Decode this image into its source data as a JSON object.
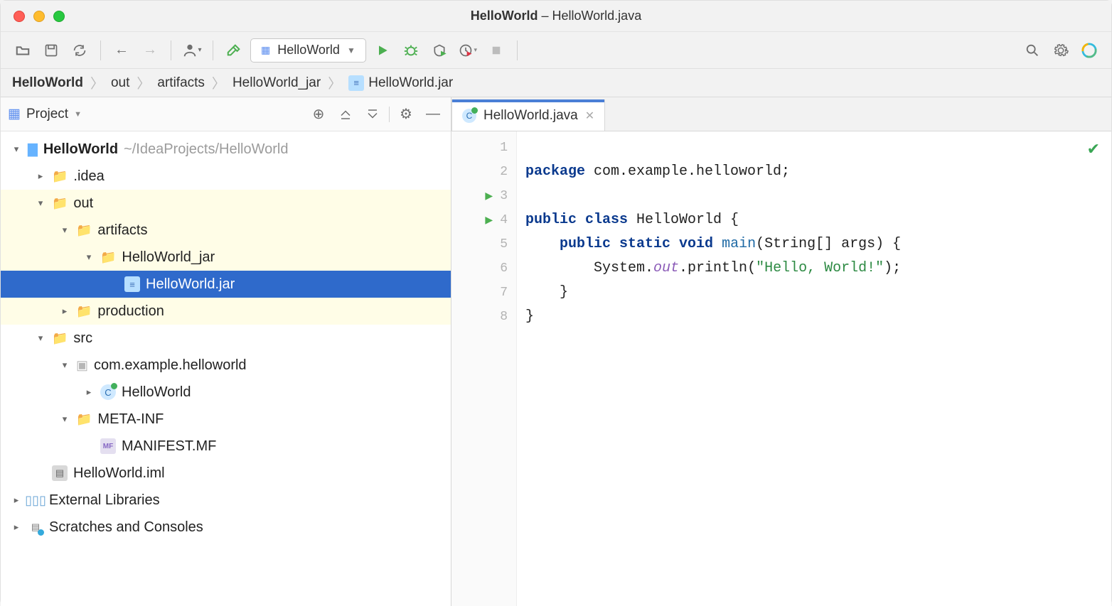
{
  "titlebar": {
    "project": "HelloWorld",
    "file": "HelloWorld.java"
  },
  "toolbar": {
    "run_config": "HelloWorld"
  },
  "breadcrumb": {
    "root": "HelloWorld",
    "out": "out",
    "artifacts": "artifacts",
    "jar_dir": "HelloWorld_jar",
    "jar": "HelloWorld.jar"
  },
  "sidebar": {
    "dropdown": "Project",
    "tree": {
      "root": {
        "name": "HelloWorld",
        "path": "~/IdeaProjects/HelloWorld"
      },
      "idea": ".idea",
      "out": "out",
      "artifacts": "artifacts",
      "jar_dir": "HelloWorld_jar",
      "jar": "HelloWorld.jar",
      "production": "production",
      "src": "src",
      "pkg": "com.example.helloworld",
      "class": "HelloWorld",
      "meta": "META-INF",
      "manifest": "MANIFEST.MF",
      "iml": "HelloWorld.iml",
      "libs": "External Libraries",
      "scratches": "Scratches and Consoles"
    }
  },
  "editor": {
    "tab": "HelloWorld.java",
    "lines": {
      "1": "package com.example.helloworld;",
      "3_kw1": "public",
      "3_kw2": "class",
      "3_name": "HelloWorld",
      "4_kw1": "public",
      "4_kw2": "static",
      "4_kw3": "void",
      "4_fn": "main",
      "4_rest": "(String[] args) {",
      "5_pre": "        System.",
      "5_out": "out",
      "5_mid": ".println(",
      "5_str": "\"Hello, World!\"",
      "5_end": ");",
      "6": "    }",
      "7": "}"
    }
  }
}
